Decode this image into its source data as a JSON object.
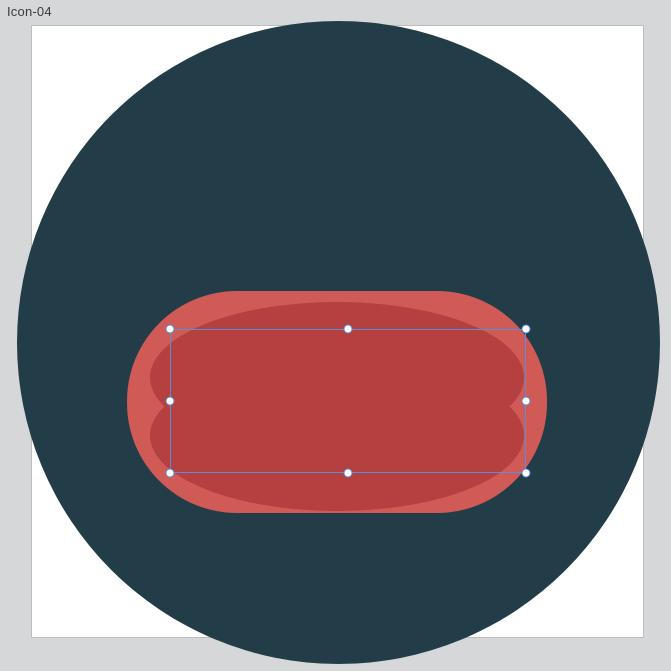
{
  "tab": {
    "label": "Icon-04"
  },
  "colors": {
    "app_bg": "#d6d7d8",
    "canvas_bg": "#ffffff",
    "circle": "#233d48",
    "shape_outer": "#d05a56",
    "shape_inner": "#b44040",
    "selection_stroke": "#5a8fd6",
    "handle_fill": "#ffffff"
  },
  "selection": {
    "handles": [
      "nw",
      "n",
      "ne",
      "w",
      "e",
      "sw",
      "s",
      "se"
    ]
  }
}
